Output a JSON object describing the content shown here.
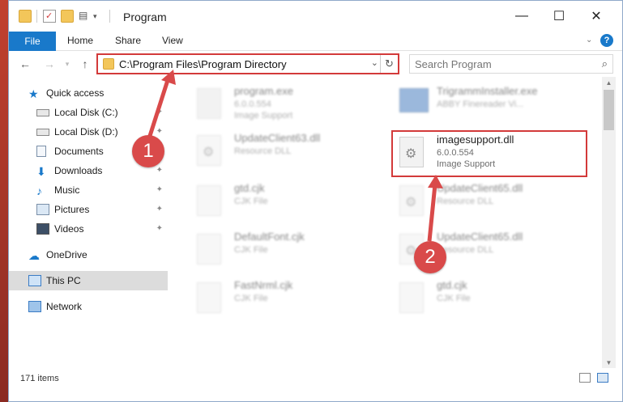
{
  "window": {
    "title": "Program"
  },
  "ribbon": {
    "tabs": [
      "File",
      "Home",
      "Share",
      "View"
    ]
  },
  "address": {
    "path": "C:\\Program Files\\Program Directory"
  },
  "search": {
    "placeholder": "Search Program"
  },
  "sidebar": {
    "items": [
      {
        "label": "Quick access",
        "icon": "star-icon"
      },
      {
        "label": "Local Disk (C:)",
        "icon": "drive-icon"
      },
      {
        "label": "Local Disk (D:)",
        "icon": "drive-icon"
      },
      {
        "label": "Documents",
        "icon": "documents-icon"
      },
      {
        "label": "Downloads",
        "icon": "download-icon"
      },
      {
        "label": "Music",
        "icon": "music-icon"
      },
      {
        "label": "Pictures",
        "icon": "pictures-icon"
      },
      {
        "label": "Videos",
        "icon": "videos-icon"
      },
      {
        "label": "OneDrive",
        "icon": "cloud-icon"
      },
      {
        "label": "This PC",
        "icon": "computer-icon"
      },
      {
        "label": "Network",
        "icon": "network-icon"
      }
    ]
  },
  "files": [
    {
      "name": "program.exe",
      "line2": "6.0.0.554",
      "line3": "Image Support",
      "icon": "exe-icon"
    },
    {
      "name": "TrigrammInstaller.exe",
      "line2": "ABBY Finereader Vi...",
      "line3": "",
      "icon": "exe-icon"
    },
    {
      "name": "UpdateClient63.dll",
      "line2": "Resource DLL",
      "line3": "",
      "icon": "gear-file-icon"
    },
    {
      "name": "imagesupport.dll",
      "line2": "6.0.0.554",
      "line3": "Image Support",
      "icon": "gear-file-icon"
    },
    {
      "name": "gtd.cjk",
      "line2": "CJK File",
      "line3": "",
      "icon": "file-icon"
    },
    {
      "name": "UpdateClient65.dll",
      "line2": "Resource DLL",
      "line3": "",
      "icon": "gear-file-icon"
    },
    {
      "name": "DefaultFont.cjk",
      "line2": "CJK File",
      "line3": "",
      "icon": "file-icon"
    },
    {
      "name": "UpdateClient65.dll",
      "line2": "Resource DLL",
      "line3": "",
      "icon": "gear-file-icon"
    },
    {
      "name": "FastNrml.cjk",
      "line2": "CJK File",
      "line3": "",
      "icon": "file-icon"
    },
    {
      "name": "gtd.cjk",
      "line2": "CJK File",
      "line3": "",
      "icon": "file-icon"
    }
  ],
  "status": {
    "item_count": "171 items"
  },
  "annotations": {
    "step1": "1",
    "step2": "2"
  },
  "colors": {
    "accent": "#1979ca",
    "annotation": "#d94a4a",
    "folder": "#f3c65a"
  }
}
